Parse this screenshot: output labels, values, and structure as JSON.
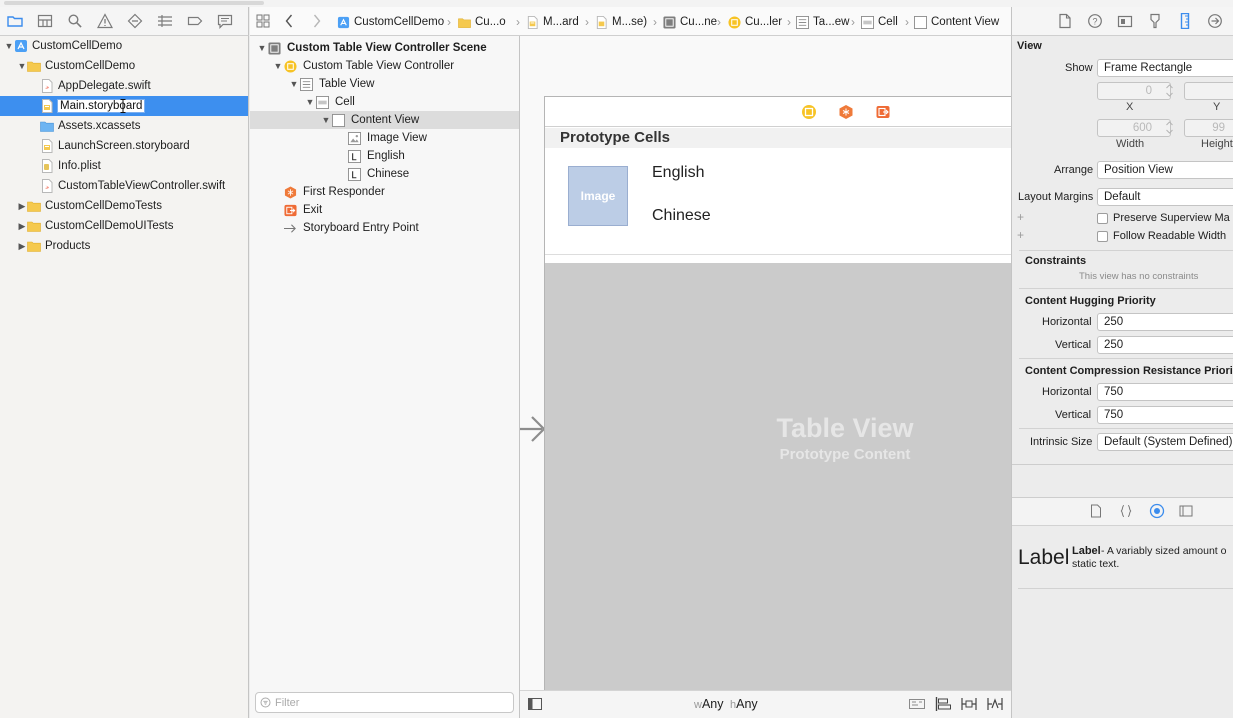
{
  "breadcrumbs": [
    {
      "label": "CustomCellDemo",
      "icon": "project-icon"
    },
    {
      "label": "Cu...o",
      "icon": "folder-icon"
    },
    {
      "label": "M...ard",
      "icon": "storyboard-file-icon"
    },
    {
      "label": "M...se)",
      "icon": "storyboard-icon"
    },
    {
      "label": "Cu...ne",
      "icon": "scene-icon"
    },
    {
      "label": "Cu...ler",
      "icon": "view-controller-icon"
    },
    {
      "label": "Ta...ew",
      "icon": "table-view-icon"
    },
    {
      "label": "Cell",
      "icon": "cell-icon"
    },
    {
      "label": "Content View",
      "icon": "view-icon"
    }
  ],
  "navigator": {
    "items": [
      {
        "label": "CustomCellDemo",
        "icon": "project-icon",
        "disclosure": "open",
        "indent": 0
      },
      {
        "label": "CustomCellDemo",
        "icon": "folder-icon",
        "disclosure": "open",
        "indent": 1
      },
      {
        "label": "AppDelegate.swift",
        "icon": "swift-file-icon",
        "disclosure": "",
        "indent": 2
      },
      {
        "label": "Main.storyboard",
        "icon": "storyboard-file-icon",
        "disclosure": "",
        "indent": 2,
        "selected": true
      },
      {
        "label": "Assets.xcassets",
        "icon": "asset-catalog-icon",
        "disclosure": "",
        "indent": 2
      },
      {
        "label": "LaunchScreen.storyboard",
        "icon": "storyboard-file-icon",
        "disclosure": "",
        "indent": 2
      },
      {
        "label": "Info.plist",
        "icon": "plist-file-icon",
        "disclosure": "",
        "indent": 2
      },
      {
        "label": "CustomTableViewController.swift",
        "icon": "swift-file-icon",
        "disclosure": "",
        "indent": 2
      },
      {
        "label": "CustomCellDemoTests",
        "icon": "folder-icon",
        "disclosure": "closed",
        "indent": 1
      },
      {
        "label": "CustomCellDemoUITests",
        "icon": "folder-icon",
        "disclosure": "closed",
        "indent": 1
      },
      {
        "label": "Products",
        "icon": "folder-icon",
        "disclosure": "closed",
        "indent": 1
      }
    ]
  },
  "outline": {
    "items": [
      {
        "label": "Custom Table View Controller Scene",
        "icon": "scene-icon",
        "disclosure": "open",
        "indent": 0,
        "bold": true
      },
      {
        "label": "Custom Table View Controller",
        "icon": "view-controller-icon",
        "disclosure": "open",
        "indent": 1
      },
      {
        "label": "Table View",
        "icon": "table-view-icon",
        "disclosure": "open",
        "indent": 2
      },
      {
        "label": "Cell",
        "icon": "cell-icon",
        "disclosure": "open",
        "indent": 3
      },
      {
        "label": "Content View",
        "icon": "view-icon",
        "disclosure": "open",
        "indent": 4,
        "highlighted": true
      },
      {
        "label": "Image View",
        "icon": "image-view-icon",
        "disclosure": "",
        "indent": 5
      },
      {
        "label": "English",
        "icon": "label-icon",
        "disclosure": "",
        "indent": 5
      },
      {
        "label": "Chinese",
        "icon": "label-icon",
        "disclosure": "",
        "indent": 5
      },
      {
        "label": "First Responder",
        "icon": "first-responder-icon",
        "disclosure": "",
        "indent": 1
      },
      {
        "label": "Exit",
        "icon": "exit-icon",
        "disclosure": "",
        "indent": 1
      },
      {
        "label": "Storyboard Entry Point",
        "icon": "entry-arrow-icon",
        "disclosure": "",
        "indent": 1
      }
    ],
    "filter_placeholder": "Filter"
  },
  "canvas": {
    "prototype_header": "Prototype Cells",
    "image_placeholder": "Image",
    "label_english": "English",
    "label_chinese": "Chinese",
    "tableview_title": "Table View",
    "tableview_subtitle": "Prototype Content",
    "size_class_w_prefix": "w",
    "size_class_w": "Any",
    "size_class_h_prefix": "h",
    "size_class_h": "Any"
  },
  "inspector": {
    "section_title": "View",
    "show_label": "Show",
    "show_value": "Frame Rectangle",
    "x_value": "0",
    "y_value": "",
    "x_label": "X",
    "y_label": "Y",
    "width_value": "600",
    "height_value": "99",
    "width_label": "Width",
    "height_label": "Height",
    "arrange_label": "Arrange",
    "arrange_value": "Position View",
    "layout_margins_label": "Layout Margins",
    "layout_margins_value": "Default",
    "preserve_label": "Preserve Superview Ma",
    "readable_label": "Follow Readable Width",
    "constraints_title": "Constraints",
    "constraints_note": "This view has no constraints",
    "hugging_title": "Content Hugging Priority",
    "hugging_h_label": "Horizontal",
    "hugging_h_value": "250",
    "hugging_v_label": "Vertical",
    "hugging_v_value": "250",
    "compression_title": "Content Compression Resistance Priority",
    "compression_h_label": "Horizontal",
    "compression_h_value": "750",
    "compression_v_label": "Vertical",
    "compression_v_value": "750",
    "intrinsic_label": "Intrinsic Size",
    "intrinsic_value": "Default (System Defined)",
    "library_label_big": "Label",
    "library_label_title": "Label",
    "library_label_desc": " - A variably sized amount o",
    "library_label_desc2": "static text."
  },
  "colors": {
    "selection": "#3d8fef",
    "folder": "#f5c94e",
    "swift": "#f05138",
    "accent": "#3b8ced"
  }
}
